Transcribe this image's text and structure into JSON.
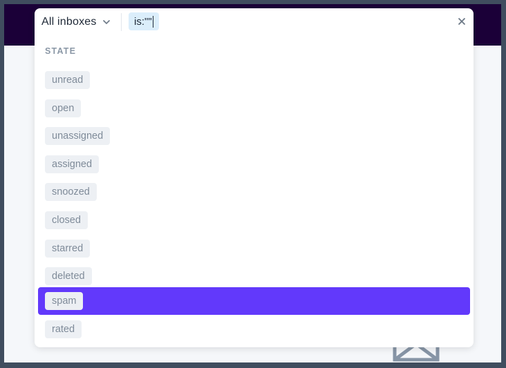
{
  "search": {
    "inbox_select_label": "All inboxes",
    "query_text": "is:\"\""
  },
  "suggestions": {
    "section_label": "STATE",
    "highlighted_index": 8,
    "options": [
      {
        "label": "unread"
      },
      {
        "label": "open"
      },
      {
        "label": "unassigned"
      },
      {
        "label": "assigned"
      },
      {
        "label": "snoozed"
      },
      {
        "label": "closed"
      },
      {
        "label": "starred"
      },
      {
        "label": "deleted"
      },
      {
        "label": "spam"
      },
      {
        "label": "rated"
      }
    ]
  },
  "colors": {
    "top_bar": "#1b0038",
    "highlight": "#6239fb",
    "tag_bg": "#edf0f4",
    "tag_text": "#7f8b99",
    "query_chip_bg": "#dbeefb"
  }
}
